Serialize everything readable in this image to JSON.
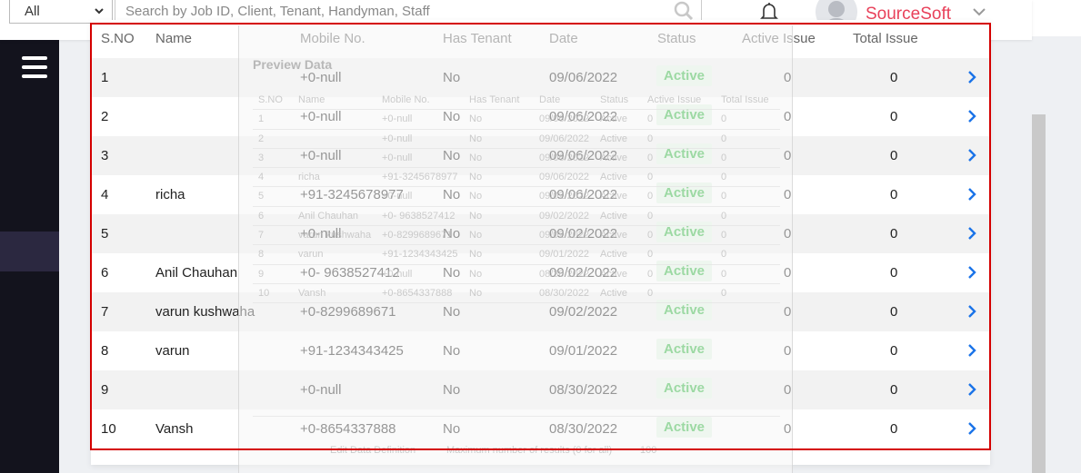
{
  "topbar": {
    "filter_value": "All",
    "search_placeholder": "Search by Job ID, Client, Tenant, Handyman, Staff",
    "brand": "SourceSoft"
  },
  "table": {
    "headers": [
      "S.NO",
      "Name",
      "Mobile No.",
      "Has Tenant",
      "Date",
      "Status",
      "Active Issue",
      "Total Issue"
    ],
    "rows": [
      {
        "sno": "1",
        "name": "",
        "mobile": "+0-null",
        "tenant": "No",
        "date": "09/06/2022",
        "status": "Active",
        "active": "0",
        "total": "0"
      },
      {
        "sno": "2",
        "name": "",
        "mobile": "+0-null",
        "tenant": "No",
        "date": "09/06/2022",
        "status": "Active",
        "active": "0",
        "total": "0"
      },
      {
        "sno": "3",
        "name": "",
        "mobile": "+0-null",
        "tenant": "No",
        "date": "09/06/2022",
        "status": "Active",
        "active": "0",
        "total": "0"
      },
      {
        "sno": "4",
        "name": "richa",
        "mobile": "+91-3245678977",
        "tenant": "No",
        "date": "09/06/2022",
        "status": "Active",
        "active": "0",
        "total": "0"
      },
      {
        "sno": "5",
        "name": "",
        "mobile": "+0-null",
        "tenant": "No",
        "date": "09/02/2022",
        "status": "Active",
        "active": "0",
        "total": "0"
      },
      {
        "sno": "6",
        "name": "Anil Chauhan",
        "mobile": "+0- 9638527412",
        "tenant": "No",
        "date": "09/02/2022",
        "status": "Active",
        "active": "0",
        "total": "0"
      },
      {
        "sno": "7",
        "name": "varun kushwaha",
        "mobile": "+0-8299689671",
        "tenant": "No",
        "date": "09/02/2022",
        "status": "Active",
        "active": "0",
        "total": "0"
      },
      {
        "sno": "8",
        "name": "varun",
        "mobile": "+91-1234343425",
        "tenant": "No",
        "date": "09/01/2022",
        "status": "Active",
        "active": "0",
        "total": "0"
      },
      {
        "sno": "9",
        "name": "",
        "mobile": "+0-null",
        "tenant": "No",
        "date": "08/30/2022",
        "status": "Active",
        "active": "0",
        "total": "0"
      },
      {
        "sno": "10",
        "name": "Vansh",
        "mobile": "+0-8654337888",
        "tenant": "No",
        "date": "08/30/2022",
        "status": "Active",
        "active": "0",
        "total": "0"
      }
    ]
  },
  "overlay": {
    "title": "Preview Data",
    "headers": [
      "S.NO",
      "Name",
      "Mobile No.",
      "Has Tenant",
      "Date",
      "Status",
      "Active Issue",
      "Total Issue"
    ],
    "rows": [
      [
        "1",
        "",
        "+0-null",
        "No",
        "09/06/2022",
        "Active",
        "0",
        "0"
      ],
      [
        "2",
        "",
        "+0-null",
        "No",
        "09/06/2022",
        "Active",
        "0",
        "0"
      ],
      [
        "3",
        "",
        "+0-null",
        "No",
        "09/06/2022",
        "Active",
        "0",
        "0"
      ],
      [
        "4",
        "richa",
        "+91-3245678977",
        "No",
        "09/06/2022",
        "Active",
        "0",
        "0"
      ],
      [
        "5",
        "",
        "+0-null",
        "No",
        "09/02/2022",
        "Active",
        "0",
        "0"
      ],
      [
        "6",
        "Anil Chauhan",
        "+0- 9638527412",
        "No",
        "09/02/2022",
        "Active",
        "0",
        "0"
      ],
      [
        "7",
        "varun kushwaha",
        "+0-8299689671",
        "No",
        "09/02/2022",
        "Active",
        "0",
        "0"
      ],
      [
        "8",
        "varun",
        "+91-1234343425",
        "No",
        "09/01/2022",
        "Active",
        "0",
        "0"
      ],
      [
        "9",
        "",
        "+0-null",
        "No",
        "08/30/2022",
        "Active",
        "0",
        "0"
      ],
      [
        "10",
        "Vansh",
        "+0-8654337888",
        "No",
        "08/30/2022",
        "Active",
        "0",
        "0"
      ]
    ],
    "footer_button": "Edit Data Definition",
    "footer_label": "Maximum number of results (0 for all)",
    "footer_value": "100"
  },
  "colors": {
    "brand": "#e8415a",
    "status_active": "#2fb53e",
    "arrow": "#1a73e8",
    "highlight": "#d40000"
  }
}
